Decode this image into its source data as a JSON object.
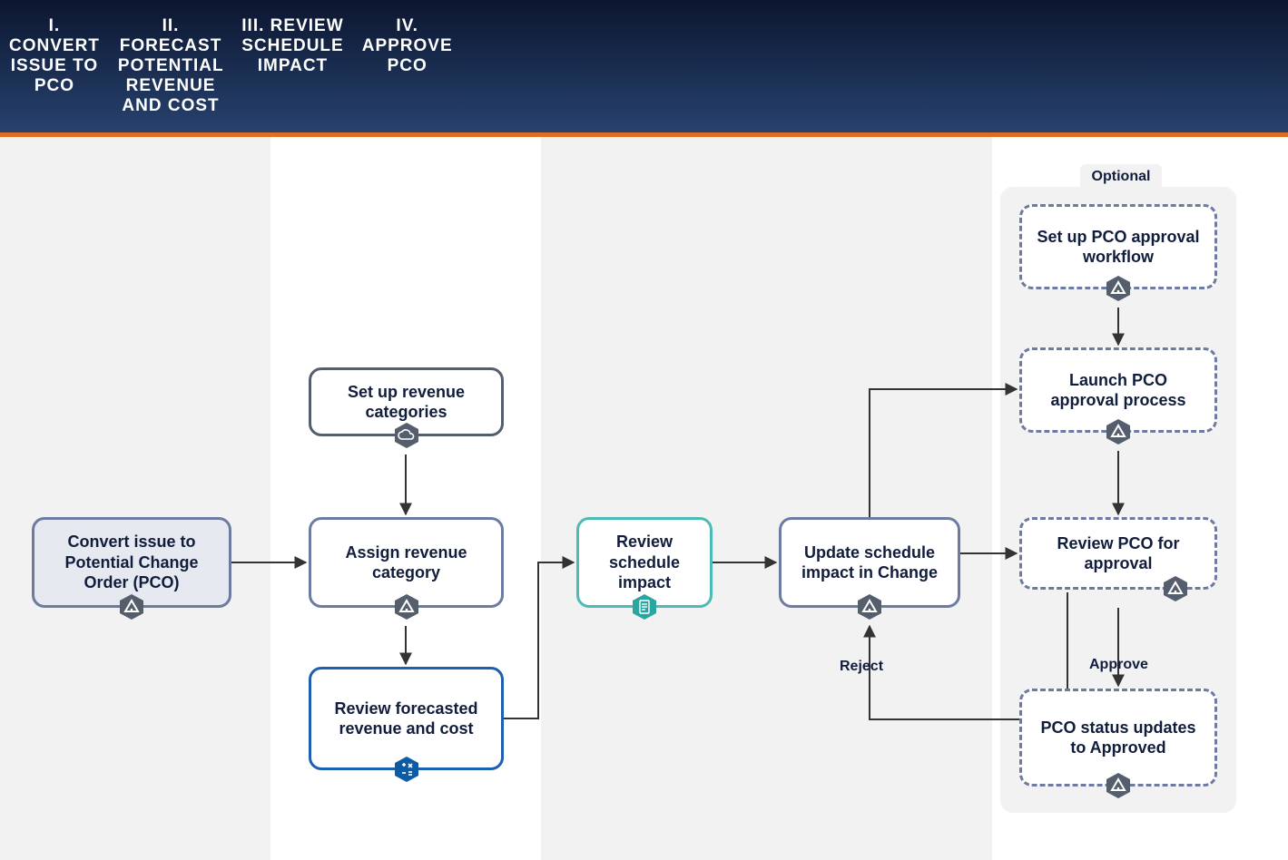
{
  "header": {
    "col1": "I. CONVERT ISSUE TO PCO",
    "col2": "II. FORECAST POTENTIAL REVENUE AND COST",
    "col3": "III. REVIEW SCHEDULE IMPACT",
    "col4": "IV. APPROVE PCO"
  },
  "optional_label": "Optional",
  "labels": {
    "reject": "Reject",
    "approve": "Approve"
  },
  "nodes": {
    "convert": {
      "text": "Convert issue to Potential Change Order (PCO)",
      "icon": "triangle-icon"
    },
    "set_categories": {
      "text": "Set up revenue categories",
      "icon": "cloud-icon"
    },
    "assign_category": {
      "text": "Assign revenue category",
      "icon": "triangle-icon"
    },
    "review_forecast": {
      "text": "Review forecasted revenue and cost",
      "icon": "calculator-icon"
    },
    "review_schedule": {
      "text": "Review schedule impact",
      "icon": "report-icon"
    },
    "update_schedule": {
      "text": "Update schedule impact in Change",
      "icon": "triangle-icon"
    },
    "setup_workflow": {
      "text": "Set up PCO approval workflow",
      "icon": "triangle-icon"
    },
    "launch_process": {
      "text": "Launch PCO approval process",
      "icon": "triangle-icon"
    },
    "review_pco": {
      "text": "Review PCO for approval",
      "icons": [
        "outlook-icon",
        "triangle-icon"
      ]
    },
    "status_approved": {
      "text": "PCO status updates to Approved",
      "icon": "triangle-icon"
    }
  },
  "edges": [
    {
      "from": "convert",
      "to": "assign_category"
    },
    {
      "from": "set_categories",
      "to": "assign_category"
    },
    {
      "from": "assign_category",
      "to": "review_forecast"
    },
    {
      "from": "review_forecast",
      "to": "review_schedule"
    },
    {
      "from": "review_schedule",
      "to": "update_schedule"
    },
    {
      "from": "update_schedule",
      "to": "launch_process"
    },
    {
      "from": "update_schedule",
      "to": "review_pco"
    },
    {
      "from": "setup_workflow",
      "to": "launch_process"
    },
    {
      "from": "launch_process",
      "to": "review_pco"
    },
    {
      "from": "review_pco",
      "to": "status_approved",
      "label": "Approve"
    },
    {
      "from": "review_pco",
      "to": "update_schedule",
      "label": "Reject"
    }
  ]
}
